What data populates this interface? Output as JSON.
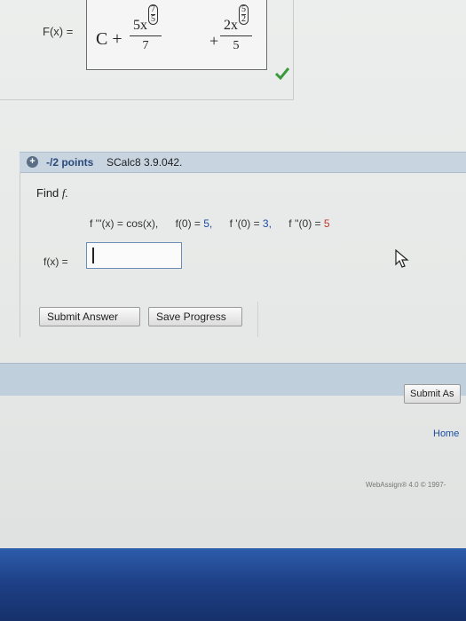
{
  "previous_answer": {
    "label": "F(x) =",
    "constant": "C +",
    "term1_num": "5x",
    "term1_exp_top": "7",
    "term1_exp_bottom": "5",
    "term1_den": "7",
    "plus": "+",
    "term2_num": "2x",
    "term2_exp_top": "5",
    "term2_exp_bottom": "2",
    "term2_den": "5"
  },
  "question": {
    "points": "-/2 points",
    "code": "SCalc8 3.9.042.",
    "prompt_prefix": "Find ",
    "prompt_var": "f.",
    "cond1": "f '''(x) = cos(x),",
    "cond2_pre": "f(0) = ",
    "cond2_val": "5,",
    "cond3_pre": "f '(0) = ",
    "cond3_val": "3,",
    "cond4_pre": "f ''(0) = ",
    "cond4_val": "5",
    "answer_label": "f(x) =",
    "answer_value": ""
  },
  "buttons": {
    "submit_answer": "Submit Answer",
    "save_progress": "Save Progress",
    "submit_all": "Submit As"
  },
  "footer": {
    "home": "Home",
    "copyright": "WebAssign® 4.0 © 1997-"
  },
  "colors": {
    "header_bar": "#c8d4e0",
    "footer_bar": "#bfcfdc",
    "check_green": "#3a9a3a",
    "link_blue": "#1c4fa0",
    "value_red": "#c0392b"
  }
}
